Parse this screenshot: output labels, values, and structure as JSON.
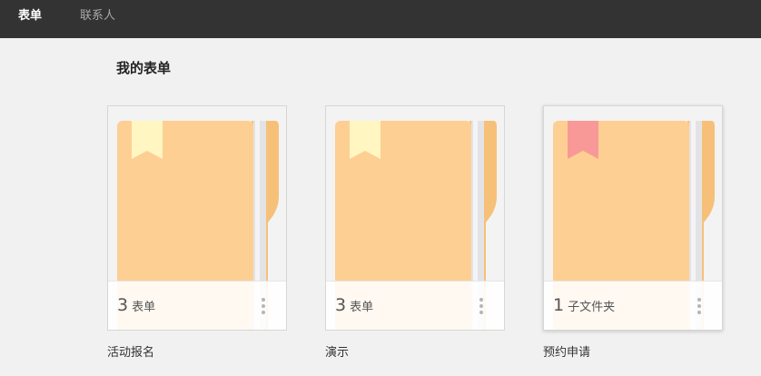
{
  "nav": {
    "tabs": [
      {
        "label": "表单",
        "active": true
      },
      {
        "label": "联系人",
        "active": false
      }
    ]
  },
  "main": {
    "title": "我的表单"
  },
  "cards": [
    {
      "name": "活动报名",
      "count": "3",
      "unit": "表单",
      "bookmark_color": "#fff6c2"
    },
    {
      "name": "演示",
      "count": "3",
      "unit": "表单",
      "bookmark_color": "#fff6c2"
    },
    {
      "name": "预约申请",
      "count": "1",
      "unit": "子文件夹",
      "bookmark_color": "#f99997"
    }
  ],
  "colors": {
    "folder": "#fdcf93",
    "folder_back": "#f7c079"
  }
}
